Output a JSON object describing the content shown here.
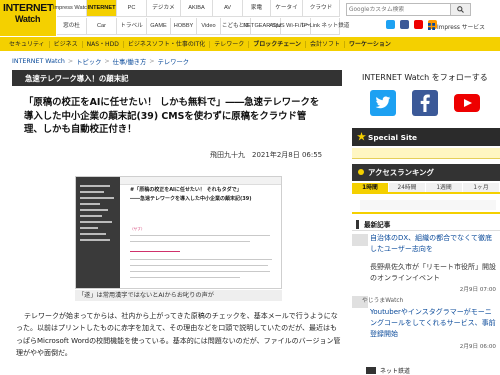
{
  "logo": {
    "line1": "INTERNET",
    "line2": "Watch"
  },
  "sites_row1": [
    "Impress Watch",
    "INTERNET",
    "PC",
    "デジカメ",
    "AKIBA",
    "AV",
    "家電",
    "ケータイ",
    "クラウド"
  ],
  "sites_row2": [
    "窓の杜",
    "Car",
    "トラベル",
    "GAME",
    "HOBBY",
    "Video",
    "こどもとIT",
    "NETGEAR Space",
    "ASUS Wi-Fiルーター",
    "TP-Link ネット鉄道"
  ],
  "site_active": "INTERNET",
  "search": {
    "placeholder": "Googleカスタム検索"
  },
  "header": {
    "impress_services": "Impress サービス"
  },
  "catnav": [
    "セキュリティ",
    "ビジネス",
    "NAS・HDD",
    "ビジネスソフト・仕事のIT化",
    "テレワーク",
    "ブロックチェーン",
    "会計ソフト",
    "ワーケーション"
  ],
  "catnav_strong": [
    "ブロックチェーン",
    "ワーケーション"
  ],
  "breadcrumb": [
    "INTERNET Watch",
    "トピック",
    "仕事/働き方",
    "テレワーク"
  ],
  "article": {
    "category": "急速テレワーク導入！の顛末記",
    "title": "「原稿の校正をAIに任せたい！ しかも無料で」――急速テレワークを導入した中小企業の顛末記(39) CMSを使わずに原稿をクラウド管理、しかも自動校正付き！",
    "byline": "飛田九十九　2021年2月8日 06:55",
    "caption": "「遂」は常用漢字ではないとAIからお叱りの声が",
    "body": "テレワークが始まってからは、社内から上がってきた原稿のチェックを、基本メールで行うようになった。以前はプリントしたものに赤字を加えて、その理由などを口頭で説明していたのだが、最近はもっぱらMicrosoft Wordの校閲機能を使っている。基本的には問題ないのだが、ファイルのバージョン管理がやや面倒だ。"
  },
  "screenshot": {
    "title": "#「原稿の校正をAIに任せたい！ それもタダで」",
    "subtitle": "――急速テレワークを導入した中小企業の顛末記(39)",
    "note": "〈サブ〉"
  },
  "sidebar": {
    "follow": "INTERNET Watch をフォローする",
    "special": "Special Site",
    "access": "アクセスランキング",
    "tabs": [
      "1時間",
      "24時間",
      "1週間",
      "1ヶ月"
    ],
    "tab_active": "1時間",
    "latest": "最新記事",
    "news": [
      {
        "title": "自治体のDX、組織の都合でなくて徹底したユーザー志向を",
        "date": "",
        "link": true
      },
      {
        "title": "長野県佐久市が「リモート市役所」開設のオンラインイベント",
        "date": "2月9日 07:00",
        "link": false
      },
      {
        "title": "Youtuberやインスタグラマーがモーニングコールをしてくれるサービス、事前登録開始",
        "date": "2月9日 06:00",
        "link": true
      }
    ],
    "source_yaru": "やじうまWatch",
    "nethk": "ネット鉄道"
  },
  "colors": {
    "brand_yellow": "#f4d000",
    "dark_bar": "#333333",
    "link": "#0a4a9a"
  },
  "icons": {
    "search": "search-icon",
    "twitter": "twitter-icon",
    "facebook": "facebook-icon",
    "youtube": "youtube-icon"
  }
}
